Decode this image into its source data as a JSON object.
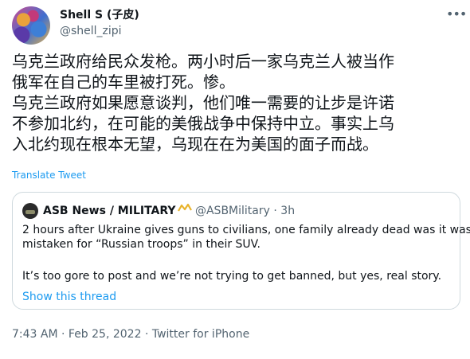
{
  "author": {
    "name": "Shell S (子皮)",
    "handle": "@shell_zipi"
  },
  "tweet": {
    "lines": [
      "乌克兰政府给民众发枪。两小时后一家乌克兰人被当作",
      "俄军在自己的车里被打死。惨。",
      "乌克兰政府如果愿意谈判，他们唯一需要的让步是许诺",
      "不参加北约，在可能的美俄战争中保持中立。事实上乌",
      "入北约现在根本无望，乌现在在为美国的面子而战。"
    ],
    "translate_label": "Translate Tweet",
    "more_icon": "ellipsis-icon"
  },
  "quoted": {
    "name": "ASB News / MILITARY",
    "handle": "@ASBMilitary",
    "separator": "·",
    "time": "3h",
    "badge_icon": "gold-chevron-icon",
    "paragraph1_lines": [
      "2 hours after Ukraine gives guns to civilians, one family already dead was it was",
      "mistaken for “Russian troops” in their SUV."
    ],
    "paragraph2": "It’s too gore to post and we’re not trying to get banned, but yes, real story.",
    "show_thread_label": "Show this thread"
  },
  "meta": {
    "time": "7:43 AM",
    "date": "Feb 25, 2022",
    "source": "Twitter for iPhone",
    "separator": "·"
  },
  "colors": {
    "link": "#1d9bf0",
    "muted": "#536471",
    "text": "#0f1419",
    "border": "#cfd9de"
  }
}
